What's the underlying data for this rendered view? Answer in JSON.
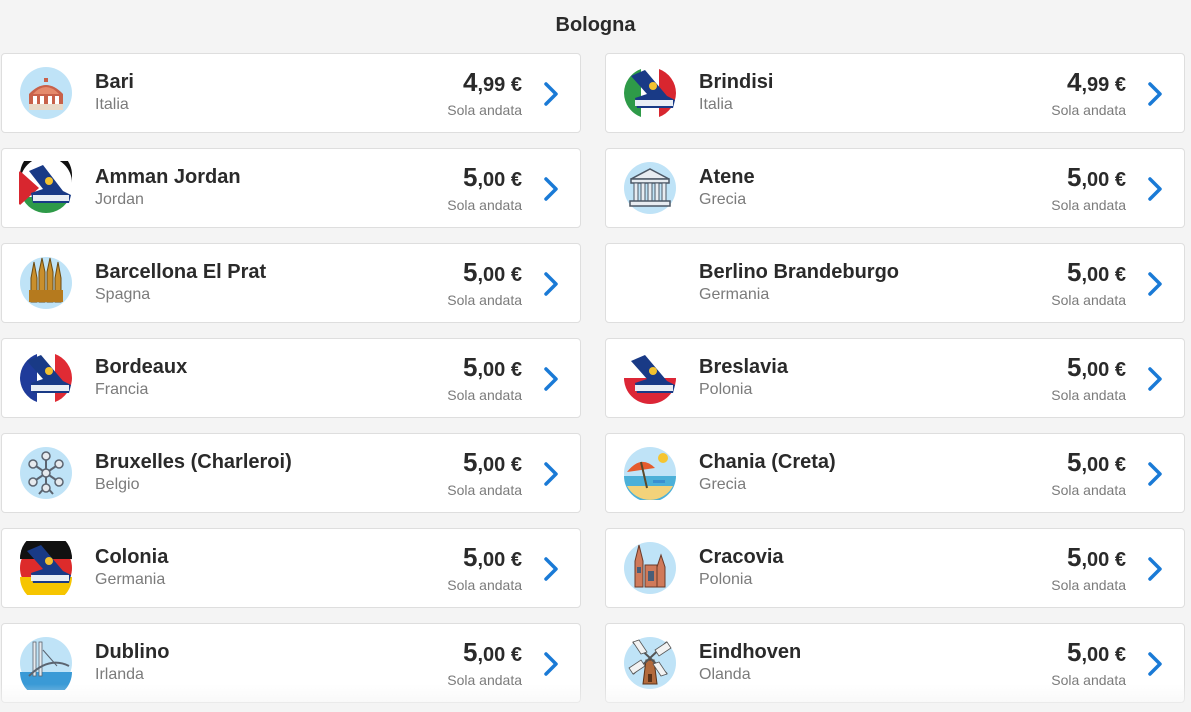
{
  "header": {
    "title": "Bologna"
  },
  "flight_label": "Sola andata",
  "colors": {
    "accent": "#1a7ad6",
    "text": "#2a2a2a",
    "muted": "#7b7b7b"
  },
  "destinations": [
    {
      "city": "Bari",
      "country": "Italia",
      "price_int": "4",
      "price_dec": ",99",
      "currency": " €",
      "icon": "bari-landmark-icon"
    },
    {
      "city": "Brindisi",
      "country": "Italia",
      "price_int": "4",
      "price_dec": ",99",
      "currency": " €",
      "icon": "ryanair-italy-flag-icon"
    },
    {
      "city": "Amman Jordan",
      "country": "Jordan",
      "price_int": "5",
      "price_dec": ",00",
      "currency": " €",
      "icon": "ryanair-jordan-flag-icon"
    },
    {
      "city": "Atene",
      "country": "Grecia",
      "price_int": "5",
      "price_dec": ",00",
      "currency": " €",
      "icon": "parthenon-icon"
    },
    {
      "city": "Barcellona El Prat",
      "country": "Spagna",
      "price_int": "5",
      "price_dec": ",00",
      "currency": " €",
      "icon": "sagrada-familia-icon"
    },
    {
      "city": "Berlino Brandeburgo",
      "country": "Germania",
      "price_int": "5",
      "price_dec": ",00",
      "currency": " €",
      "icon": ""
    },
    {
      "city": "Bordeaux",
      "country": "Francia",
      "price_int": "5",
      "price_dec": ",00",
      "currency": " €",
      "icon": "ryanair-france-flag-icon"
    },
    {
      "city": "Breslavia",
      "country": "Polonia",
      "price_int": "5",
      "price_dec": ",00",
      "currency": " €",
      "icon": "ryanair-poland-flag-icon"
    },
    {
      "city": "Bruxelles (Charleroi)",
      "country": "Belgio",
      "price_int": "5",
      "price_dec": ",00",
      "currency": " €",
      "icon": "atomium-icon"
    },
    {
      "city": "Chania (Creta)",
      "country": "Grecia",
      "price_int": "5",
      "price_dec": ",00",
      "currency": " €",
      "icon": "beach-umbrella-icon"
    },
    {
      "city": "Colonia",
      "country": "Germania",
      "price_int": "5",
      "price_dec": ",00",
      "currency": " €",
      "icon": "ryanair-germany-flag-icon"
    },
    {
      "city": "Cracovia",
      "country": "Polonia",
      "price_int": "5",
      "price_dec": ",00",
      "currency": " €",
      "icon": "krakow-church-icon"
    },
    {
      "city": "Dublino",
      "country": "Irlanda",
      "price_int": "5",
      "price_dec": ",00",
      "currency": " €",
      "icon": "dublin-bridge-icon"
    },
    {
      "city": "Eindhoven",
      "country": "Olanda",
      "price_int": "5",
      "price_dec": ",00",
      "currency": " €",
      "icon": "windmill-icon"
    }
  ]
}
